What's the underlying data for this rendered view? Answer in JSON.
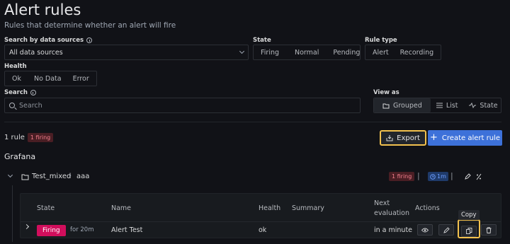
{
  "header": {
    "title": "Alert rules",
    "subtitle": "Rules that determine whether an alert will fire"
  },
  "filters": {
    "datasource_label": "Search by data sources",
    "datasource_value": "All data sources",
    "state_label": "State",
    "state_options": [
      "Firing",
      "Normal",
      "Pending"
    ],
    "ruletype_label": "Rule type",
    "ruletype_options": [
      "Alert",
      "Recording"
    ],
    "health_label": "Health",
    "health_options": [
      "Ok",
      "No Data",
      "Error"
    ],
    "search_label": "Search",
    "search_placeholder": "Search",
    "view_label": "View as",
    "view_options": [
      "Grouped",
      "List",
      "State"
    ],
    "view_selected": "Grouped"
  },
  "summary": {
    "count": "1 rule",
    "firing_badge": "1 firing"
  },
  "toolbar": {
    "export_label": "Export",
    "create_label": "Create alert rule"
  },
  "section_title": "Grafana",
  "group": {
    "folder": "Test_mixed",
    "separator": "›",
    "name": "aaa",
    "firing_badge": "1 firing",
    "divider": "|",
    "interval": "1m"
  },
  "table": {
    "headers": [
      "State",
      "Name",
      "Health",
      "Summary",
      "Next evaluation",
      "Actions"
    ],
    "next_eval_line1": "Next",
    "next_eval_line2": "evaluation",
    "rows": [
      {
        "state": "Firing",
        "duration": "for 20m",
        "name": "Alert Test",
        "health": "ok",
        "summary": "",
        "next": "in a minute"
      }
    ]
  },
  "tooltip": "Copy",
  "colors": {
    "accent": "#3d71d9",
    "firing": "#d10e5c",
    "highlight": "#f2c14e"
  }
}
